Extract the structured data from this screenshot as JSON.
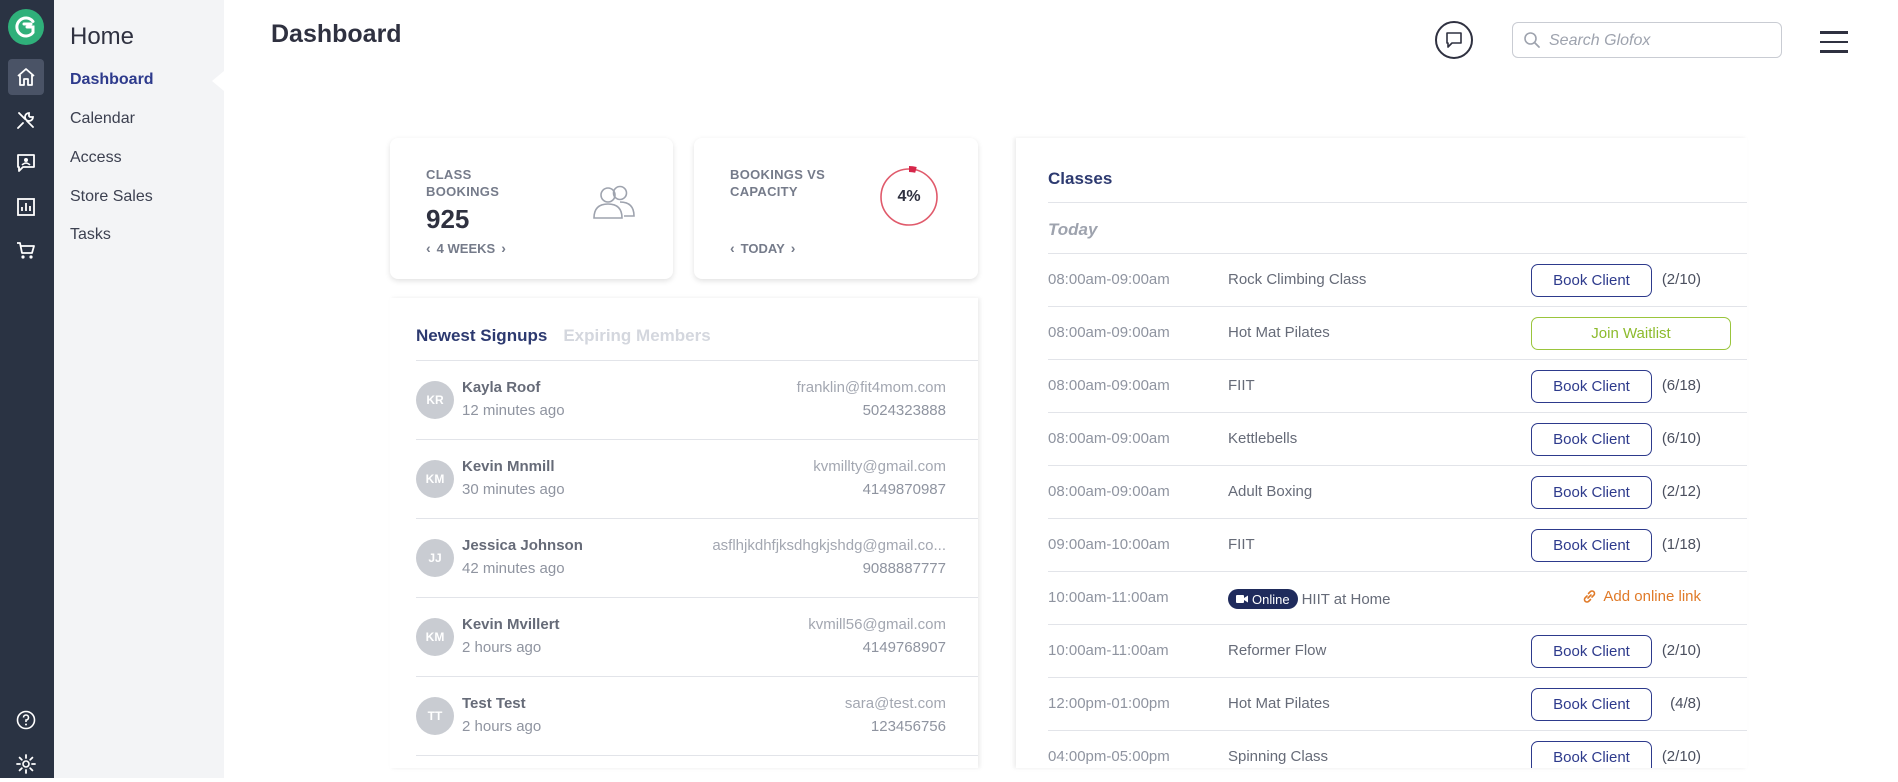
{
  "rail": {
    "icons": [
      "logo-icon",
      "home-icon",
      "tools-icon",
      "messages-icon",
      "reports-icon",
      "cart-icon",
      "help-icon",
      "settings-icon"
    ]
  },
  "subnav": {
    "title": "Home",
    "items": [
      {
        "label": "Dashboard",
        "active": true
      },
      {
        "label": "Calendar"
      },
      {
        "label": "Access"
      },
      {
        "label": "Store Sales"
      },
      {
        "label": "Tasks"
      }
    ]
  },
  "header": {
    "title": "Dashboard",
    "search_placeholder": "Search Glofox"
  },
  "stats": {
    "class_bookings": {
      "label": "CLASS BOOKINGS",
      "value": "925",
      "period": "4 WEEKS"
    },
    "bookings_vs_capacity": {
      "label": "BOOKINGS VS CAPACITY",
      "value": "4%",
      "fraction": 0.04,
      "period": "TODAY"
    }
  },
  "signups": {
    "tabs": [
      "Newest Signups",
      "Expiring Members"
    ],
    "rows": [
      {
        "initials": "KR",
        "name": "Kayla Roof",
        "ago": "12 minutes ago",
        "email": "franklin@fit4mom.com",
        "phone": "5024323888"
      },
      {
        "initials": "KM",
        "name": "Kevin Mnmill",
        "ago": "30 minutes ago",
        "email": "kvmillty@gmail.com",
        "phone": "4149870987"
      },
      {
        "initials": "JJ",
        "name": "Jessica Johnson",
        "ago": "42 minutes ago",
        "email": "asflhjkdhfjksdhgkjshdg@gmail.co...",
        "phone": "9088887777"
      },
      {
        "initials": "KM",
        "name": "Kevin Mvillert",
        "ago": "2 hours ago",
        "email": "kvmill56@gmail.com",
        "phone": "4149768907"
      },
      {
        "initials": "TT",
        "name": "Test Test",
        "ago": "2 hours ago",
        "email": "sara@test.com",
        "phone": "123456756"
      }
    ]
  },
  "classes": {
    "title": "Classes",
    "day": "Today",
    "book_label": "Book Client",
    "waitlist_label": "Join Waitlist",
    "online_label": "Online",
    "online_link_label": "Add online link",
    "colors": {
      "primary": "#2d3a8c",
      "waitlist": "#9ac53c",
      "online_link": "#e07a28"
    },
    "rows": [
      {
        "time": "08:00am-09:00am",
        "name": "Rock Climbing Class",
        "action": "book",
        "capacity": "(2/10)"
      },
      {
        "time": "08:00am-09:00am",
        "name": "Hot Mat Pilates",
        "action": "waitlist",
        "capacity": ""
      },
      {
        "time": "08:00am-09:00am",
        "name": "FIIT",
        "action": "book",
        "capacity": "(6/18)"
      },
      {
        "time": "08:00am-09:00am",
        "name": "Kettlebells",
        "action": "book",
        "capacity": "(6/10)"
      },
      {
        "time": "08:00am-09:00am",
        "name": "Adult Boxing",
        "action": "book",
        "capacity": "(2/12)"
      },
      {
        "time": "09:00am-10:00am",
        "name": "FIIT",
        "action": "book",
        "capacity": "(1/18)"
      },
      {
        "time": "10:00am-11:00am",
        "name": "HIIT at Home",
        "action": "online",
        "capacity": ""
      },
      {
        "time": "10:00am-11:00am",
        "name": "Reformer Flow",
        "action": "book",
        "capacity": "(2/10)"
      },
      {
        "time": "12:00pm-01:00pm",
        "name": "Hot Mat Pilates",
        "action": "book",
        "capacity": "(4/8)"
      },
      {
        "time": "04:00pm-05:00pm",
        "name": "Spinning Class",
        "action": "book",
        "capacity": "(2/10)"
      }
    ]
  }
}
